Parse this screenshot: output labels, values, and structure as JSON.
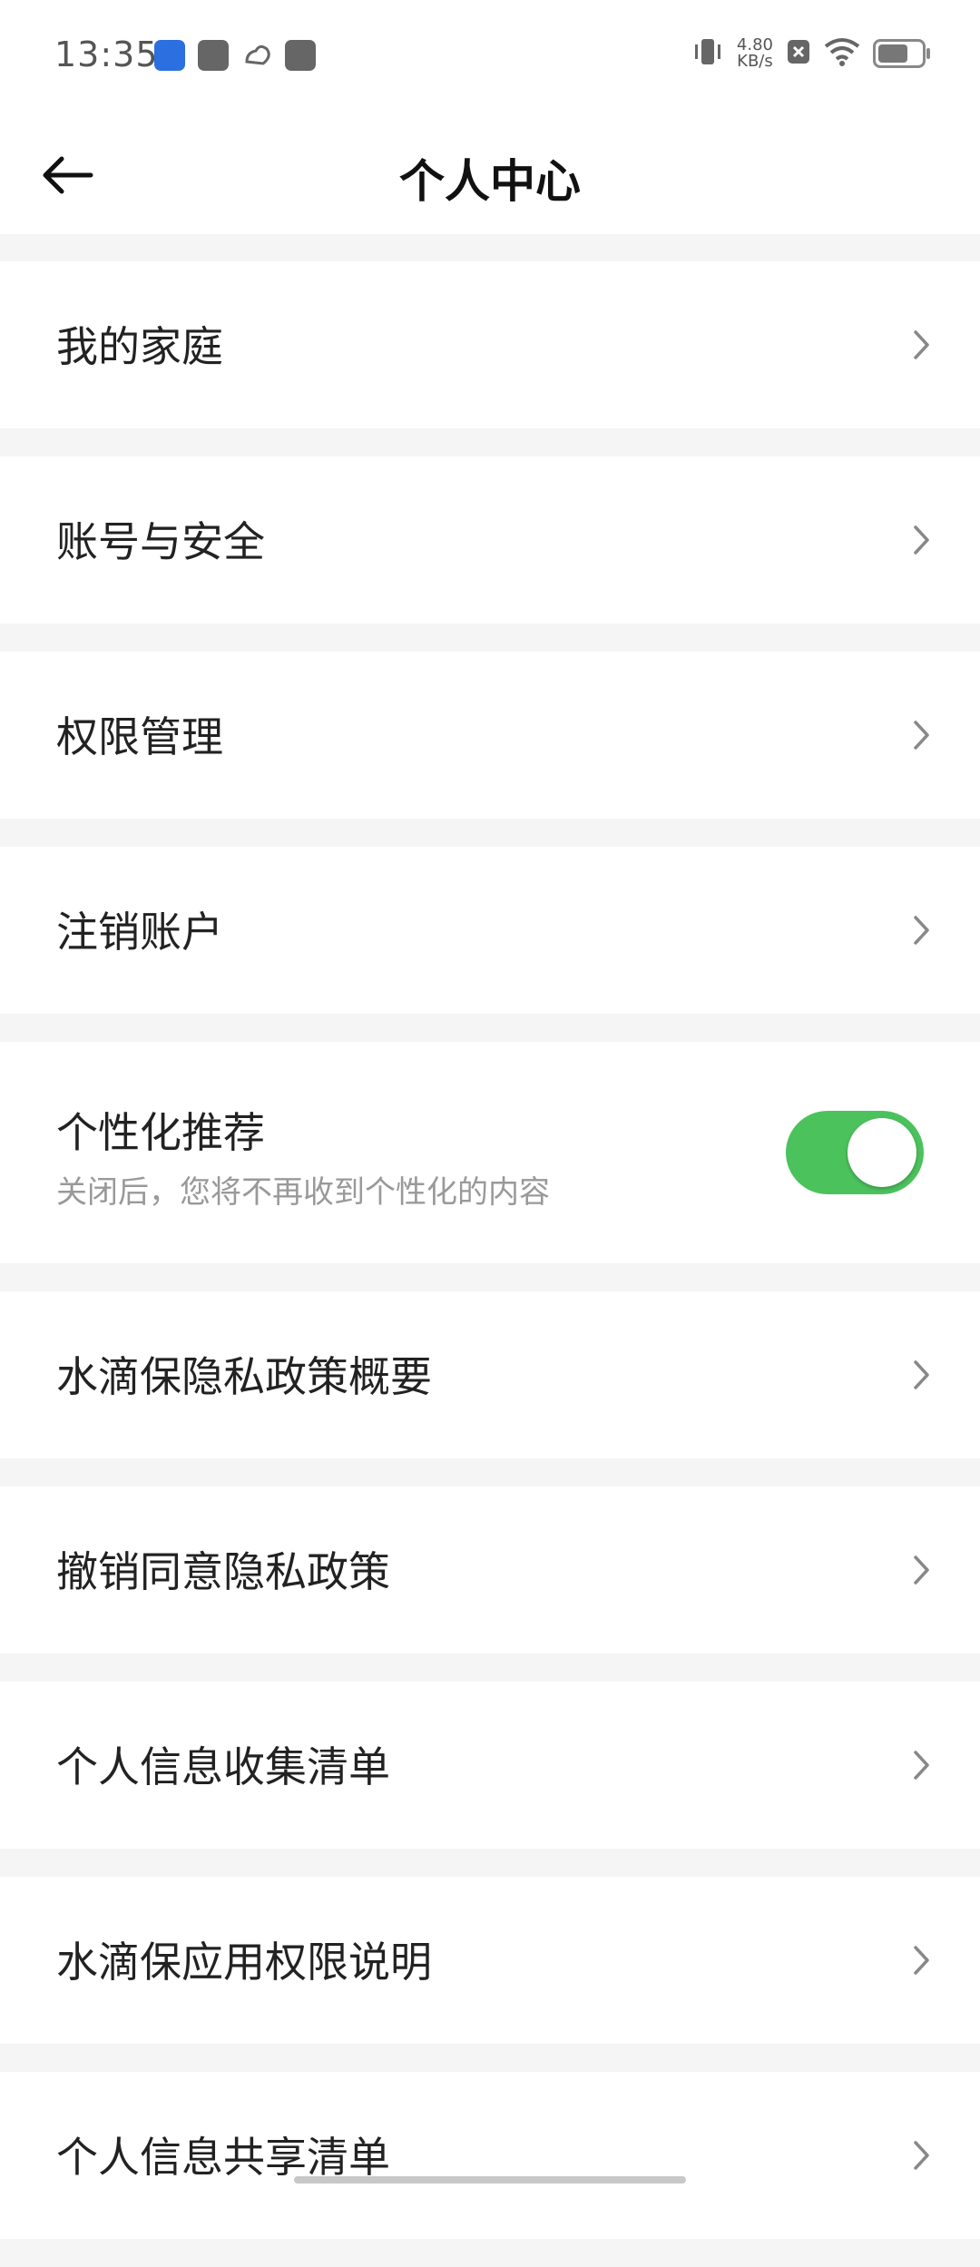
{
  "status_bar": {
    "time": "13:35",
    "net_speed_value": "4.80",
    "net_speed_unit": "KB/s",
    "icons": [
      "app-notification-icon",
      "mail-icon",
      "cloud-icon",
      "inbox-icon",
      "vibrate-icon",
      "close-box-icon",
      "wifi-icon",
      "battery-icon"
    ]
  },
  "header": {
    "title": "个人中心",
    "back_icon": "arrow-left-icon"
  },
  "menu": {
    "items": [
      {
        "label": "我的家庭"
      },
      {
        "label": "账号与安全"
      },
      {
        "label": "权限管理"
      },
      {
        "label": "注销账户"
      }
    ],
    "personalization": {
      "title": "个性化推荐",
      "subtitle": "关闭后，您将不再收到个性化的内容",
      "enabled": true,
      "accent_color": "#4cc25d"
    },
    "items2": [
      {
        "label": "水滴保隐私政策概要"
      },
      {
        "label": "撤销同意隐私政策"
      },
      {
        "label": "个人信息收集清单"
      },
      {
        "label": "水滴保应用权限说明"
      },
      {
        "label": "个人信息共享清单"
      }
    ]
  }
}
